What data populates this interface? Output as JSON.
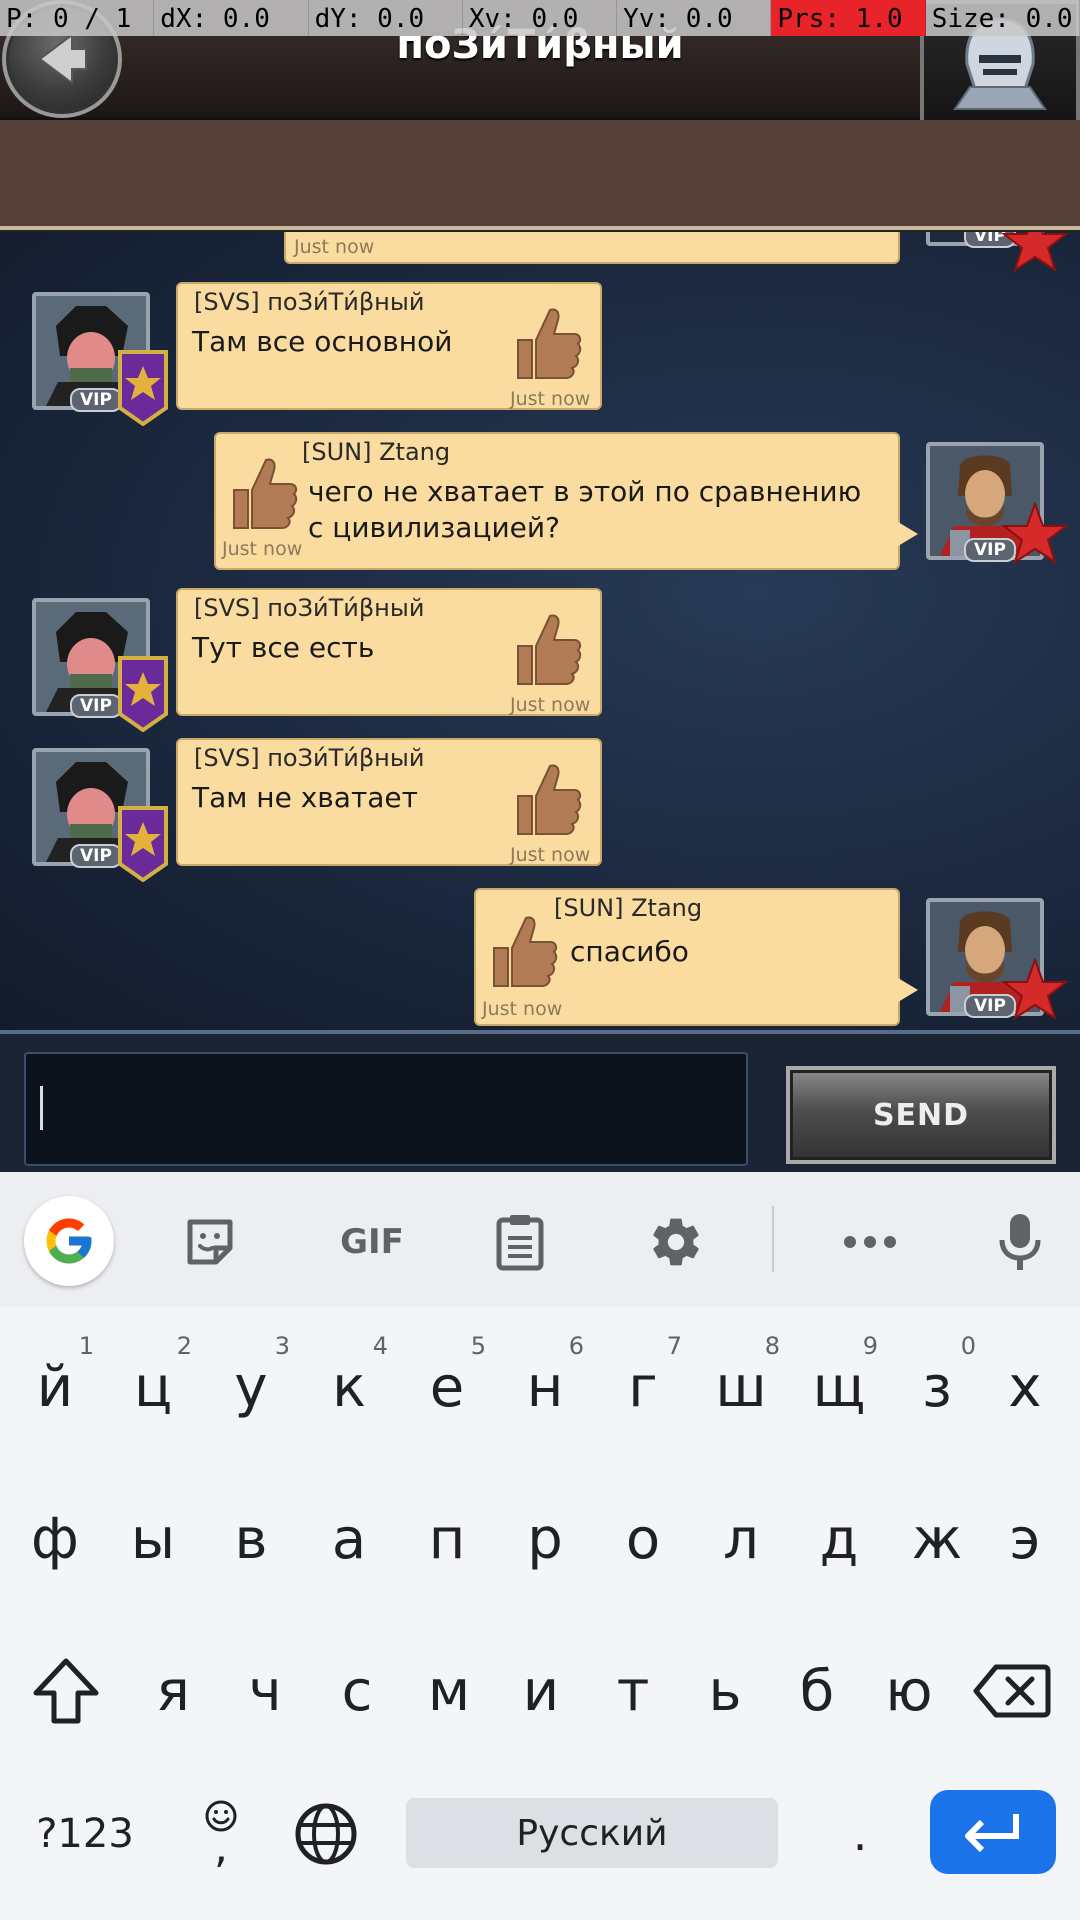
{
  "debug_bar": {
    "items": [
      {
        "label": "P: 0 / 1",
        "hot": false
      },
      {
        "label": "dX: 0.0",
        "hot": false
      },
      {
        "label": "dY: 0.0",
        "hot": false
      },
      {
        "label": "Xv: 0.0",
        "hot": false
      },
      {
        "label": "Yv: 0.0",
        "hot": false
      },
      {
        "label": "Prs: 1.0",
        "hot": true
      },
      {
        "label": "Size: 0.0",
        "hot": false
      }
    ]
  },
  "header": {
    "title": "поЗи́Ти́βный"
  },
  "chat": {
    "partial_time": "Just now",
    "messages": [
      {
        "id": "m1",
        "side": "left",
        "sender": "[SVS] поЗи́Ти́βный",
        "text": "Там все основной",
        "time": "Just now"
      },
      {
        "id": "m2",
        "side": "right",
        "sender": "[SUN] Ztang",
        "text": "чего не хватает в этой по сравнению с цивилизацией?",
        "time": "Just now"
      },
      {
        "id": "m3",
        "side": "left",
        "sender": "[SVS] поЗи́Ти́βный",
        "text": "Тут все есть",
        "time": "Just now"
      },
      {
        "id": "m4",
        "side": "left",
        "sender": "[SVS] поЗи́Ти́βный",
        "text": "Там не хватает",
        "time": "Just now"
      },
      {
        "id": "m5",
        "side": "right",
        "sender": "[SUN] Ztang",
        "text": "спасибо",
        "time": "Just now"
      }
    ],
    "vip_label": "VIP"
  },
  "composer": {
    "input_value": "",
    "send_label": "SEND"
  },
  "keyboard": {
    "toolbar": {
      "gif_label": "GIF",
      "icons": [
        "google-icon",
        "sticker-icon",
        "gif-icon",
        "clipboard-icon",
        "settings-icon",
        "more-icon",
        "mic-icon"
      ]
    },
    "row1": [
      {
        "key": "й",
        "hint": "1"
      },
      {
        "key": "ц",
        "hint": "2"
      },
      {
        "key": "у",
        "hint": "3"
      },
      {
        "key": "к",
        "hint": "4"
      },
      {
        "key": "е",
        "hint": "5"
      },
      {
        "key": "н",
        "hint": "6"
      },
      {
        "key": "г",
        "hint": "7"
      },
      {
        "key": "ш",
        "hint": "8"
      },
      {
        "key": "щ",
        "hint": "9"
      },
      {
        "key": "з",
        "hint": "0"
      },
      {
        "key": "х",
        "hint": ""
      }
    ],
    "row2": [
      "ф",
      "ы",
      "в",
      "а",
      "п",
      "р",
      "о",
      "л",
      "д",
      "ж",
      "э"
    ],
    "row3": [
      "я",
      "ч",
      "с",
      "м",
      "и",
      "т",
      "ь",
      "б",
      "ю"
    ],
    "symbols_label": "?123",
    "comma_label": ",",
    "space_label": "Русский",
    "period_label": "."
  },
  "colors": {
    "bubble": "#fbdca0",
    "chat_bg": "#1b283e",
    "enter_key": "#1a73e8",
    "hot_debug": "#e8232a"
  }
}
